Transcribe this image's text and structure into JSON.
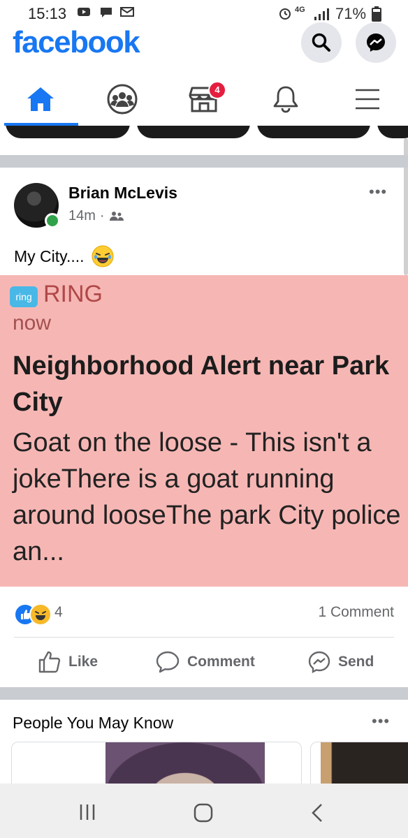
{
  "status_bar": {
    "time": "15:13",
    "network": "4G",
    "battery": "71%"
  },
  "header": {
    "brand": "facebook"
  },
  "nav": {
    "tabs": [
      {
        "name": "home",
        "active": true
      },
      {
        "name": "groups",
        "active": false
      },
      {
        "name": "marketplace",
        "badge": "4"
      },
      {
        "name": "notifications",
        "active": false
      },
      {
        "name": "menu",
        "active": false
      }
    ]
  },
  "post": {
    "author": "Brian McLevis",
    "time": "14m",
    "dot": "·",
    "text": "My City....",
    "more": "•••",
    "shared_image": {
      "app_logo_text": "ring",
      "app_name": "RING",
      "time": "now",
      "title": "Neighborhood Alert near Park City",
      "body": "Goat on the loose - This isn't a jokeThere is a goat running around looseThe park City police an..."
    },
    "reaction_count": "4",
    "comment_count": "1 Comment",
    "actions": {
      "like": "Like",
      "comment": "Comment",
      "send": "Send"
    }
  },
  "people_you_may_know": {
    "title": "People You May Know",
    "more": "•••"
  },
  "colors": {
    "brand_blue": "#1877f2",
    "badge_red": "#e41e3f",
    "image_bg": "#f6b7b4",
    "online_green": "#31a24c"
  }
}
